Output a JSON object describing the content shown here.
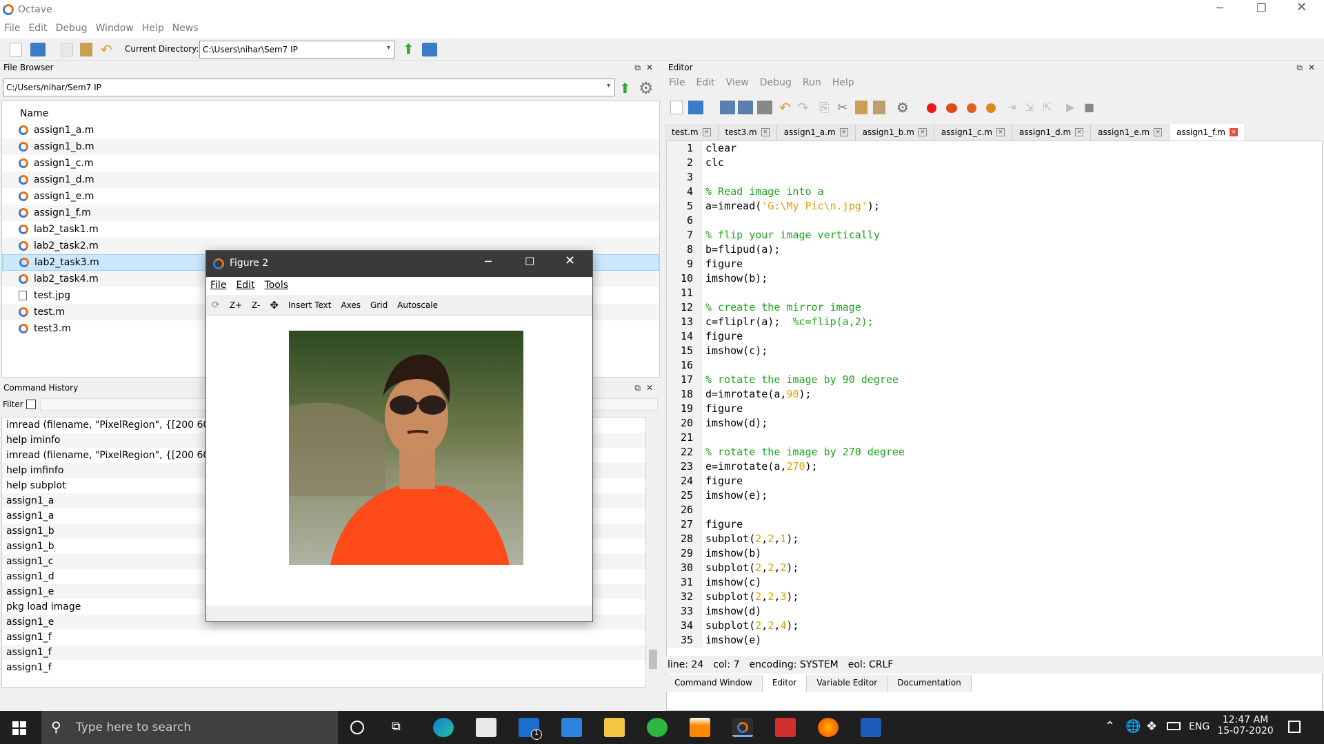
{
  "app": {
    "title": "Octave"
  },
  "menubar": [
    "File",
    "Edit",
    "Debug",
    "Window",
    "Help",
    "News"
  ],
  "toolbar": {
    "current_dir_label": "Current Directory:",
    "current_dir_value": "C:\\Users\\nihar\\Sem7 IP"
  },
  "file_browser": {
    "title": "File Browser",
    "path": "C:/Users/nihar/Sem7 IP",
    "column_header": "Name",
    "files": [
      {
        "name": "assign1_a.m",
        "type": "m"
      },
      {
        "name": "assign1_b.m",
        "type": "m"
      },
      {
        "name": "assign1_c.m",
        "type": "m"
      },
      {
        "name": "assign1_d.m",
        "type": "m"
      },
      {
        "name": "assign1_e.m",
        "type": "m"
      },
      {
        "name": "assign1_f.m",
        "type": "m"
      },
      {
        "name": "lab2_task1.m",
        "type": "m"
      },
      {
        "name": "lab2_task2.m",
        "type": "m"
      },
      {
        "name": "lab2_task3.m",
        "type": "m",
        "selected": true
      },
      {
        "name": "lab2_task4.m",
        "type": "m"
      },
      {
        "name": "test.jpg",
        "type": "img"
      },
      {
        "name": "test.m",
        "type": "m"
      },
      {
        "name": "test3.m",
        "type": "m"
      }
    ]
  },
  "command_history": {
    "title": "Command History",
    "filter_label": "Filter",
    "items": [
      "imread (filename, \"PixelRegion\", {[200 600],",
      "help iminfo",
      "imread (filename, \"PixelRegion\", {[200 600],",
      "help imfinfo",
      "help subplot",
      "assign1_a",
      "assign1_a",
      "assign1_b",
      "assign1_b",
      "assign1_c",
      "assign1_d",
      "assign1_e",
      "pkg load image",
      "assign1_e",
      "assign1_f",
      "assign1_f",
      "assign1_f"
    ]
  },
  "figure": {
    "title": "Figure 2",
    "menu": [
      "File",
      "Edit",
      "Tools"
    ],
    "toolbar": [
      "Z+",
      "Z-",
      "Insert Text",
      "Axes",
      "Grid",
      "Autoscale"
    ]
  },
  "editor": {
    "title": "Editor",
    "menu": [
      "File",
      "Edit",
      "View",
      "Debug",
      "Run",
      "Help"
    ],
    "tabs": [
      "test.m",
      "test3.m",
      "assign1_a.m",
      "assign1_b.m",
      "assign1_c.m",
      "assign1_d.m",
      "assign1_e.m",
      "assign1_f.m"
    ],
    "active_tab": 7,
    "lines": [
      {
        "n": "1",
        "segs": [
          {
            "t": "clear",
            "c": "normal"
          }
        ]
      },
      {
        "n": "2",
        "segs": [
          {
            "t": "clc",
            "c": "normal"
          }
        ]
      },
      {
        "n": "3",
        "segs": []
      },
      {
        "n": "4",
        "segs": [
          {
            "t": "% Read image into a",
            "c": "comment"
          }
        ]
      },
      {
        "n": "5",
        "segs": [
          {
            "t": "a=imread(",
            "c": "normal"
          },
          {
            "t": "'G:\\My Pic\\n.jpg'",
            "c": "str"
          },
          {
            "t": ");",
            "c": "normal"
          }
        ]
      },
      {
        "n": "6",
        "segs": []
      },
      {
        "n": "7",
        "segs": [
          {
            "t": "% flip your image vertically",
            "c": "comment"
          }
        ]
      },
      {
        "n": "8",
        "segs": [
          {
            "t": "b=flipud(a);",
            "c": "normal"
          }
        ]
      },
      {
        "n": "9",
        "segs": [
          {
            "t": "figure",
            "c": "normal"
          }
        ]
      },
      {
        "n": "10",
        "segs": [
          {
            "t": "imshow(b);",
            "c": "normal"
          }
        ]
      },
      {
        "n": "11",
        "segs": []
      },
      {
        "n": "12",
        "segs": [
          {
            "t": "% create the mirror image",
            "c": "comment"
          }
        ]
      },
      {
        "n": "13",
        "segs": [
          {
            "t": "c=fliplr(a);  ",
            "c": "normal"
          },
          {
            "t": "%c=flip(a,2);",
            "c": "comment"
          }
        ]
      },
      {
        "n": "14",
        "segs": [
          {
            "t": "figure",
            "c": "normal"
          }
        ]
      },
      {
        "n": "15",
        "segs": [
          {
            "t": "imshow(c);",
            "c": "normal"
          }
        ]
      },
      {
        "n": "16",
        "segs": []
      },
      {
        "n": "17",
        "segs": [
          {
            "t": "% rotate the image by 90 degree",
            "c": "comment"
          }
        ]
      },
      {
        "n": "18",
        "segs": [
          {
            "t": "d=imrotate(a,",
            "c": "normal"
          },
          {
            "t": "90",
            "c": "num"
          },
          {
            "t": ");",
            "c": "normal"
          }
        ]
      },
      {
        "n": "19",
        "segs": [
          {
            "t": "figure",
            "c": "normal"
          }
        ]
      },
      {
        "n": "20",
        "segs": [
          {
            "t": "imshow(d);",
            "c": "normal"
          }
        ]
      },
      {
        "n": "21",
        "segs": []
      },
      {
        "n": "22",
        "segs": [
          {
            "t": "% rotate the image by 270 degree",
            "c": "comment"
          }
        ]
      },
      {
        "n": "23",
        "segs": [
          {
            "t": "e=imrotate(a,",
            "c": "normal"
          },
          {
            "t": "270",
            "c": "num"
          },
          {
            "t": ");",
            "c": "normal"
          }
        ]
      },
      {
        "n": "24",
        "segs": [
          {
            "t": "figure",
            "c": "normal"
          }
        ]
      },
      {
        "n": "25",
        "segs": [
          {
            "t": "imshow(e);",
            "c": "normal"
          }
        ]
      },
      {
        "n": "26",
        "segs": []
      },
      {
        "n": "27",
        "segs": [
          {
            "t": "figure",
            "c": "normal"
          }
        ]
      },
      {
        "n": "28",
        "segs": [
          {
            "t": "subplot(",
            "c": "normal"
          },
          {
            "t": "2",
            "c": "num"
          },
          {
            "t": ",",
            "c": "normal"
          },
          {
            "t": "2",
            "c": "num"
          },
          {
            "t": ",",
            "c": "normal"
          },
          {
            "t": "1",
            "c": "num"
          },
          {
            "t": ");",
            "c": "normal"
          }
        ]
      },
      {
        "n": "29",
        "segs": [
          {
            "t": "imshow(b)",
            "c": "normal"
          }
        ]
      },
      {
        "n": "30",
        "segs": [
          {
            "t": "subplot(",
            "c": "normal"
          },
          {
            "t": "2",
            "c": "num"
          },
          {
            "t": ",",
            "c": "normal"
          },
          {
            "t": "2",
            "c": "num"
          },
          {
            "t": ",",
            "c": "normal"
          },
          {
            "t": "2",
            "c": "num"
          },
          {
            "t": ");",
            "c": "normal"
          }
        ]
      },
      {
        "n": "31",
        "segs": [
          {
            "t": "imshow(c)",
            "c": "normal"
          }
        ]
      },
      {
        "n": "32",
        "segs": [
          {
            "t": "subplot(",
            "c": "normal"
          },
          {
            "t": "2",
            "c": "num"
          },
          {
            "t": ",",
            "c": "normal"
          },
          {
            "t": "2",
            "c": "num"
          },
          {
            "t": ",",
            "c": "normal"
          },
          {
            "t": "3",
            "c": "num"
          },
          {
            "t": ");",
            "c": "normal"
          }
        ]
      },
      {
        "n": "33",
        "segs": [
          {
            "t": "imshow(d)",
            "c": "normal"
          }
        ]
      },
      {
        "n": "34",
        "segs": [
          {
            "t": "subplot(",
            "c": "normal"
          },
          {
            "t": "2",
            "c": "num"
          },
          {
            "t": ",",
            "c": "normal"
          },
          {
            "t": "2",
            "c": "num"
          },
          {
            "t": ",",
            "c": "normal"
          },
          {
            "t": "4",
            "c": "num"
          },
          {
            "t": ");",
            "c": "normal"
          }
        ]
      },
      {
        "n": "35",
        "segs": [
          {
            "t": "imshow(e)",
            "c": "normal"
          }
        ]
      }
    ],
    "status": {
      "line": "line: 24",
      "col": "col: 7",
      "encoding": "encoding: SYSTEM",
      "eol": "eol: CRLF"
    }
  },
  "bottom_tabs": [
    "Command Window",
    "Editor",
    "Variable Editor",
    "Documentation"
  ],
  "bottom_active": 1,
  "taskbar": {
    "search_placeholder": "Type here to search",
    "lang": "ENG",
    "time": "12:47 AM",
    "date": "15-07-2020",
    "mail_badge": "1"
  },
  "colors": {
    "accent": "#3d7bc6",
    "octave_orange": "#e8701a",
    "taskbar": "#1f1f1f",
    "comment": "#1aa51a",
    "string": "#e0a000"
  }
}
